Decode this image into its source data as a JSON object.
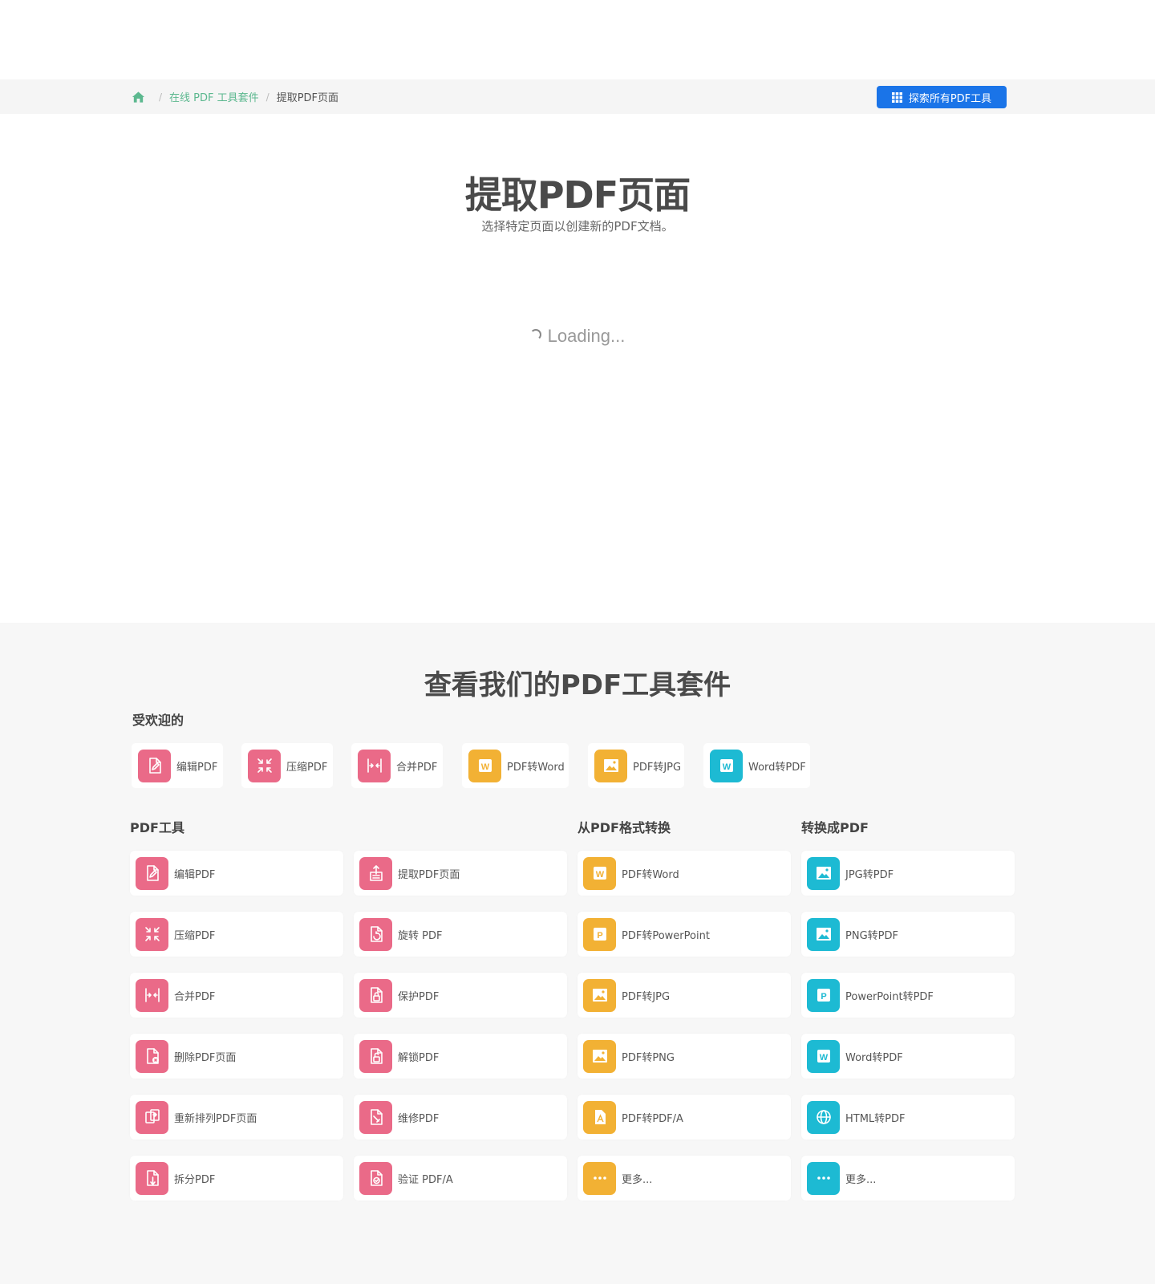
{
  "breadcrumb": {
    "link": "在线 PDF 工具套件",
    "current": "提取PDF页面",
    "separator": "/"
  },
  "explore_button": "探索所有PDF工具",
  "hero": {
    "title": "提取PDF页面",
    "subtitle": "选择特定页面以创建新的PDF文档。"
  },
  "loading_text": "Loading...",
  "suite": {
    "title": "查看我们的PDF工具套件",
    "popular_label": "受欢迎的",
    "popular": [
      {
        "label": "编辑PDF",
        "icon": "edit-file-icon",
        "color": "pink"
      },
      {
        "label": "压缩PDF",
        "icon": "compress-icon",
        "color": "pink"
      },
      {
        "label": "合并PDF",
        "icon": "merge-icon",
        "color": "pink"
      },
      {
        "label": "PDF转Word",
        "icon": "word-icon",
        "color": "orange"
      },
      {
        "label": "PDF转JPG",
        "icon": "image-icon",
        "color": "orange"
      },
      {
        "label": "Word转PDF",
        "icon": "word-icon",
        "color": "teal"
      }
    ],
    "pdf_tools_label": "PDF工具",
    "from_pdf_label": "从PDF格式转换",
    "to_pdf_label": "转换成PDF",
    "pdf_tools_col1": [
      {
        "label": "编辑PDF",
        "icon": "edit-file-icon"
      },
      {
        "label": "压缩PDF",
        "icon": "compress-icon"
      },
      {
        "label": "合并PDF",
        "icon": "merge-icon"
      },
      {
        "label": "删除PDF页面",
        "icon": "delete-pages-icon"
      },
      {
        "label": "重新排列PDF页面",
        "icon": "reorder-pages-icon"
      },
      {
        "label": "拆分PDF",
        "icon": "split-icon"
      }
    ],
    "pdf_tools_col2": [
      {
        "label": "提取PDF页面",
        "icon": "extract-pages-icon"
      },
      {
        "label": "旋转 PDF",
        "icon": "rotate-icon"
      },
      {
        "label": "保护PDF",
        "icon": "lock-file-icon"
      },
      {
        "label": "解锁PDF",
        "icon": "unlock-file-icon"
      },
      {
        "label": "维修PDF",
        "icon": "repair-file-icon"
      },
      {
        "label": "验证 PDF/A",
        "icon": "validate-file-icon"
      }
    ],
    "from_pdf": [
      {
        "label": "PDF转Word",
        "icon": "word-icon"
      },
      {
        "label": "PDF转PowerPoint",
        "icon": "powerpoint-icon"
      },
      {
        "label": "PDF转JPG",
        "icon": "image-icon"
      },
      {
        "label": "PDF转PNG",
        "icon": "image-icon"
      },
      {
        "label": "PDF转PDF/A",
        "icon": "pdfa-icon"
      },
      {
        "label": "更多...",
        "icon": "more-icon"
      }
    ],
    "to_pdf": [
      {
        "label": "JPG转PDF",
        "icon": "image-icon"
      },
      {
        "label": "PNG转PDF",
        "icon": "image-icon"
      },
      {
        "label": "PowerPoint转PDF",
        "icon": "powerpoint-icon"
      },
      {
        "label": "Word转PDF",
        "icon": "word-icon"
      },
      {
        "label": "HTML转PDF",
        "icon": "globe-icon"
      },
      {
        "label": "更多...",
        "icon": "more-icon"
      }
    ]
  },
  "colors": {
    "pink": "#ea6a88",
    "orange": "#f2b134",
    "teal": "#1dbad3",
    "primary_button": "#1a74e8",
    "breadcrumb_link": "#5cb88f"
  }
}
